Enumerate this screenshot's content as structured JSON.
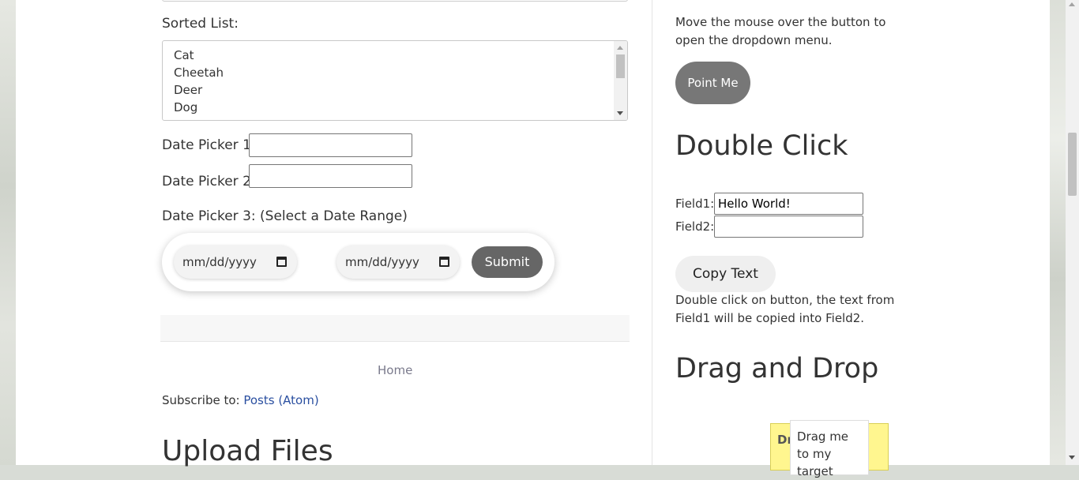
{
  "main": {
    "sorted_list": {
      "label": "Sorted List:",
      "items": [
        "Cat",
        "Cheetah",
        "Deer",
        "Dog"
      ]
    },
    "date_picker_1": {
      "label": "Date Picker 1:",
      "value": ""
    },
    "date_picker_2": {
      "label": "Date Picker 2:",
      "value": ""
    },
    "date_picker_3": {
      "label": "Date Picker 3: (Select a Date Range)",
      "start_placeholder": "mm/dd/yyyy",
      "end_placeholder": "mm/dd/yyyy",
      "submit_label": "Submit"
    },
    "footer": {
      "home_link": "Home",
      "subscribe_prefix": "Subscribe to: ",
      "subscribe_link": "Posts (Atom)"
    },
    "upload_heading": "Upload Files"
  },
  "sidebar": {
    "hover_instructions": "Move the mouse over the button to open the dropdown menu.",
    "point_button": "Point Me",
    "double_click": {
      "heading": "Double Click",
      "field1_label": "Field1:",
      "field1_value": "Hello World!",
      "field2_label": "Field2:",
      "field2_value": "",
      "copy_button": "Copy Text",
      "description": "Double click on button, the text from Field1 will be copied into Field2."
    },
    "drag_drop": {
      "heading": "Drag and Drop",
      "target_text": "Dr",
      "draggable_text": "Drag me to my target"
    }
  },
  "colors": {
    "button_dark": "#666666",
    "link_blue": "#2a4fa0",
    "drop_target_yellow": "#fff68f"
  }
}
